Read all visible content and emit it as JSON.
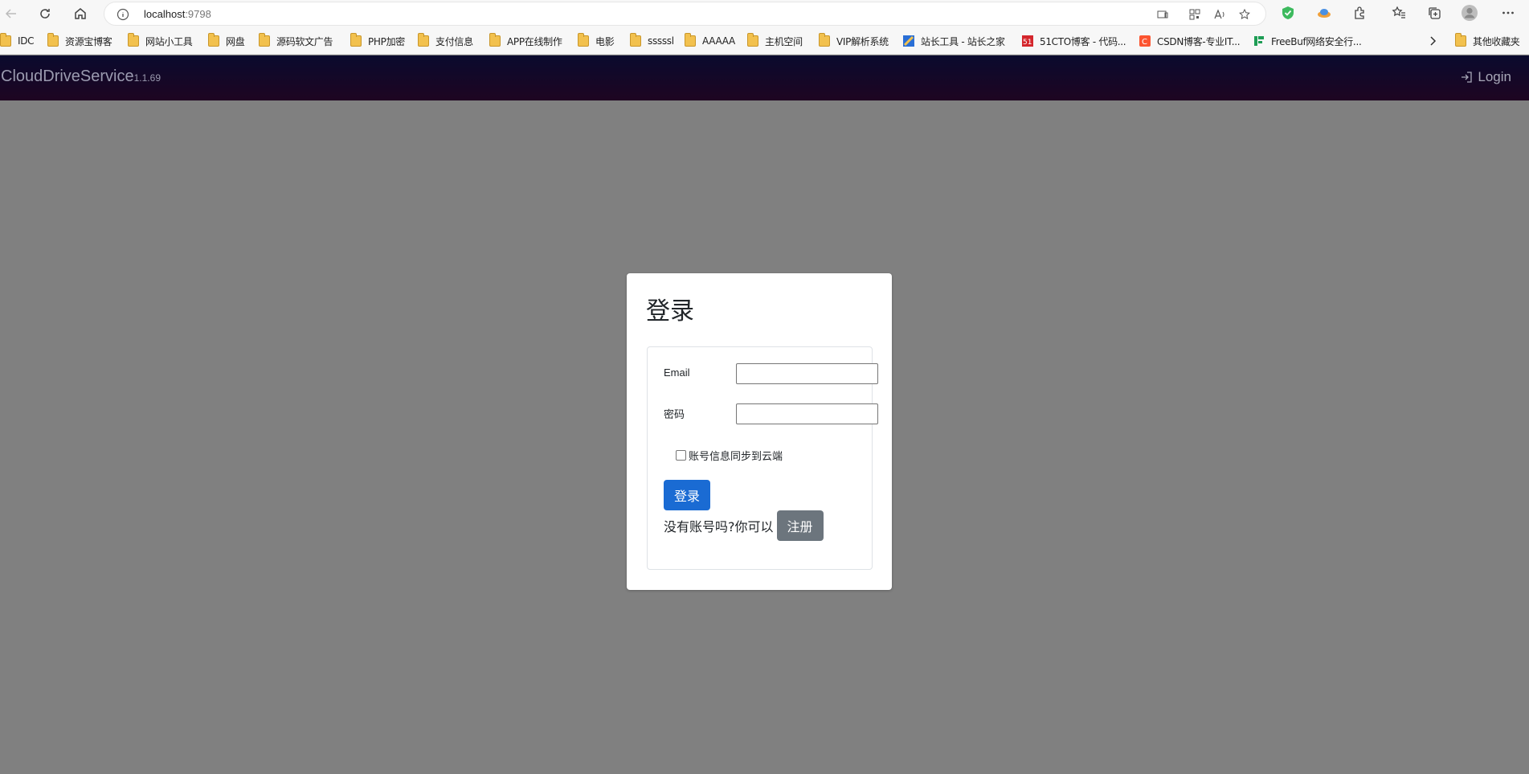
{
  "browser": {
    "url_host": "localhost",
    "url_port": ":9798",
    "bookmarks": [
      "IDC",
      "资源宝博客",
      "网站小工具",
      "网盘",
      "源码软文广告",
      "PHP加密",
      "支付信息",
      "APP在线制作",
      "电影",
      "sssssl",
      "AAAAA",
      "主机空间",
      "VIP解析系统",
      "站长工具 - 站长之家",
      "51CTO博客 - 代码...",
      "CSDN博客-专业IT...",
      "FreeBuf网络安全行..."
    ],
    "other_bookmarks": "其他收藏夹"
  },
  "navbar": {
    "brand": "CloudDriveService",
    "version": "1.1.69",
    "login": "Login"
  },
  "login_form": {
    "title": "登录",
    "email_label": "Email",
    "email_value": "",
    "password_label": "密码",
    "password_value": "",
    "remember_label": "账号信息同步到云端",
    "remember_checked": false,
    "submit_label": "登录",
    "register_prompt": "没有账号吗?你可以",
    "register_label": "注册"
  },
  "colors": {
    "page_bg": "#808080",
    "navbar_start": "#0a0a2e",
    "navbar_end": "#1e0521",
    "primary_button": "#1a6bd3",
    "secondary_button": "#6c757d"
  }
}
